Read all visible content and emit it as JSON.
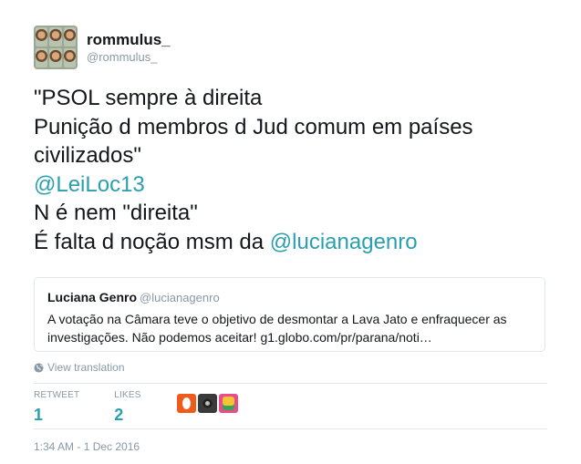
{
  "author": {
    "name": "rommulus_",
    "handle": "@rommulus_"
  },
  "tweet": {
    "lines": [
      {
        "text": "\"PSOL sempre à direita"
      },
      {
        "text": "Punição d membros d Jud comum em países"
      },
      {
        "text": "civilizados\""
      },
      {
        "mention": "@LeiLoc13"
      },
      {
        "text": "N é nem \"direita\""
      },
      {
        "text": "É falta d noção msm da ",
        "mention": "@lucianagenro"
      }
    ]
  },
  "quoted_tweet": {
    "name": "Luciana Genro",
    "handle": "@lucianagenro",
    "text": "A votação na Câmara teve o objetivo de desmontar a Lava Jato e enfraquecer as investigações. Não podemos aceitar! g1.globo.com/pr/parana/noti…"
  },
  "translation_label": "View translation",
  "stats": {
    "retweet_label": "RETWEET",
    "retweet_count": "1",
    "likes_label": "LIKES",
    "likes_count": "2"
  },
  "likers": [
    {
      "icon": "orange-egg-avatar"
    },
    {
      "icon": "camera-avatar"
    },
    {
      "icon": "colorful-art-avatar"
    }
  ],
  "timestamp": "1:34 AM - 1 Dec 2016",
  "colors": {
    "accent": "#2a9fae",
    "muted": "#8899a6",
    "border": "#e1e8ed"
  }
}
